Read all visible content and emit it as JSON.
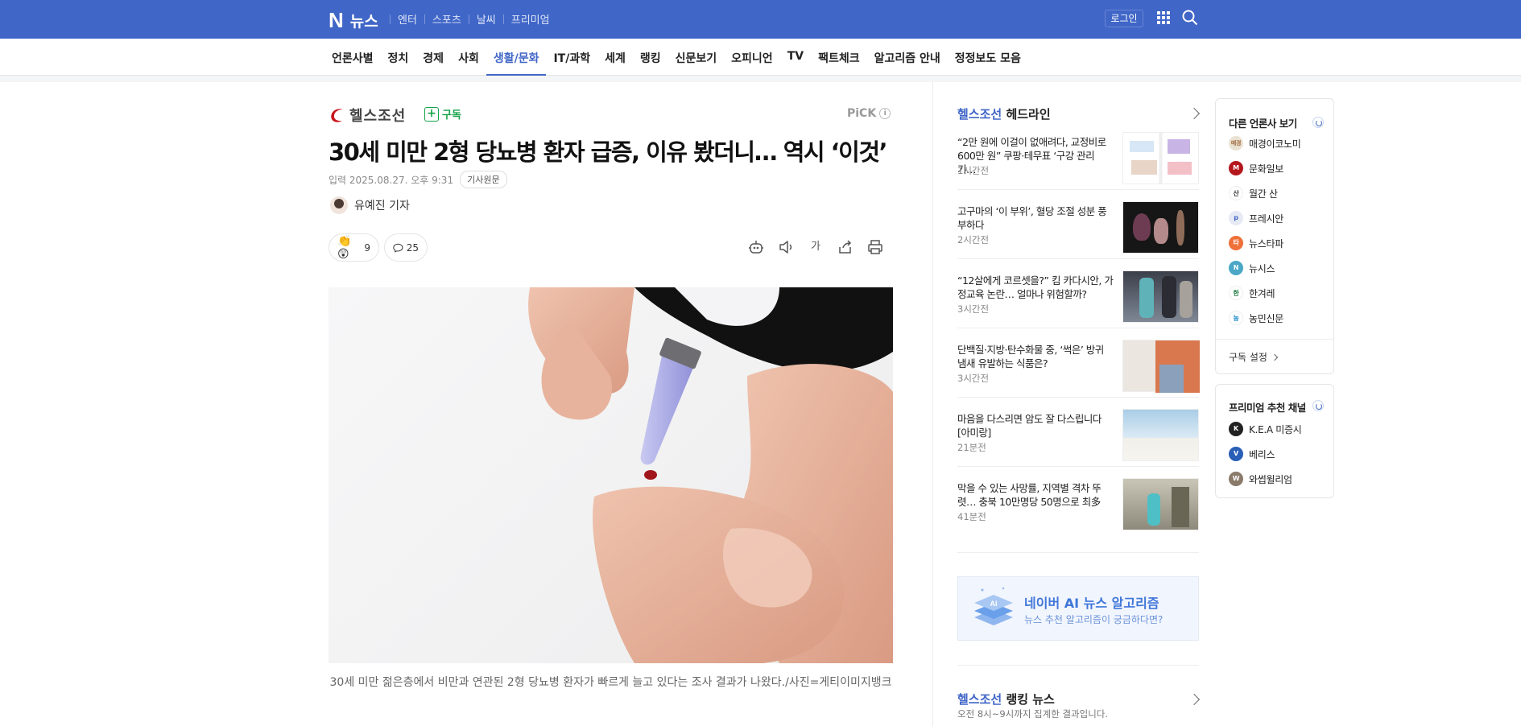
{
  "topbar": {
    "logo_n": "N",
    "logo_text": "뉴스",
    "nav": [
      "엔터",
      "스포츠",
      "날씨",
      "프리미엄"
    ],
    "login": "로그인",
    "color": "#4066c7"
  },
  "sections": [
    "언론사별",
    "정치",
    "경제",
    "사회",
    "생활/문화",
    "IT/과학",
    "세계",
    "랭킹",
    "신문보기",
    "오피니언",
    "TV",
    "팩트체크",
    "알고리즘 안내",
    "정정보도 모음"
  ],
  "active_section": "생활/문화",
  "article": {
    "press": "헬스조선",
    "subscribe": "구독",
    "pick": "PiCK",
    "title": "30세 미만 2형 당뇨병 환자 급증, 이유 봤더니… 역시 ‘이것’",
    "date": "입력 2025.08.27. 오후 9:31",
    "original_link": "기사원문",
    "reporter": "유예진 기자",
    "reaction_count": "9",
    "comment_count": "25",
    "font_tool": "가",
    "caption": "30세 미만 젊은층에서 비만과 연관된 2형 당뇨병 환자가 빠르게 늘고 있다는 조사 결과가 나왔다./사진=게티이미지뱅크"
  },
  "headlines": {
    "brand": "헬스조선",
    "label": "헤드라인",
    "items": [
      {
        "text": "“2만 원에 이걸이 없애려다, 교정비로 600만 원” 쿠팡·테무표 ‘구강 관리 기…",
        "time": "1시간전"
      },
      {
        "text": "고구마의 ‘이 부위’, 혈당 조절 성분 풍부하다",
        "time": "2시간전"
      },
      {
        "text": "“12살에게 코르셋을?” 킴 카다시안, 가정교육 논란… 얼마나 위험할까?",
        "time": "3시간전"
      },
      {
        "text": "단백질·지방·탄수화물 중, ‘썩은’ 방귀 냄새 유발하는 식품은?",
        "time": "3시간전"
      },
      {
        "text": "마음을 다스리면 암도 잘 다스립니다 [아미랑]",
        "time": "21분전"
      },
      {
        "text": "막을 수 있는 사망률, 지역별 격차 뚜렷… 충북 10만명당 50명으로 최多",
        "time": "41분전"
      }
    ]
  },
  "ai_box": {
    "title": "네이버 AI 뉴스 알고리즘",
    "subtitle": "뉴스 추천 알고리즘이 궁금하다면?",
    "badge": "AI"
  },
  "ranking": {
    "brand": "헬스조선",
    "label": "랭킹 뉴스",
    "subtitle": "오전 8시~9시까지 집계한 결과입니다."
  },
  "other_press": {
    "title": "다른 언론사 보기",
    "items": [
      {
        "name": "매경이코노미",
        "color": "#e9e2d3",
        "mark": "매경"
      },
      {
        "name": "문화일보",
        "color": "#b5171e",
        "mark": "M"
      },
      {
        "name": "월간 산",
        "color": "#ffffff",
        "mark": "산"
      },
      {
        "name": "프레시안",
        "color": "#e6eaf4",
        "mark": "p"
      },
      {
        "name": "뉴스타파",
        "color": "#f0703a",
        "mark": "타"
      },
      {
        "name": "뉴시스",
        "color": "#4ba7c6",
        "mark": "N"
      },
      {
        "name": "한겨레",
        "color": "#ffffff",
        "mark": "한"
      },
      {
        "name": "농민신문",
        "color": "#ffffff",
        "mark": "농"
      }
    ],
    "setting": "구독 설정"
  },
  "premium": {
    "title": "프리미엄 추천 채널",
    "items": [
      {
        "name": "K.E.A 미증시",
        "color": "#222222",
        "mark": "K"
      },
      {
        "name": "베리스",
        "color": "#2a5fb8",
        "mark": "V"
      },
      {
        "name": "와썹윌리엄",
        "color": "#8a7a6a",
        "mark": "W"
      }
    ]
  }
}
